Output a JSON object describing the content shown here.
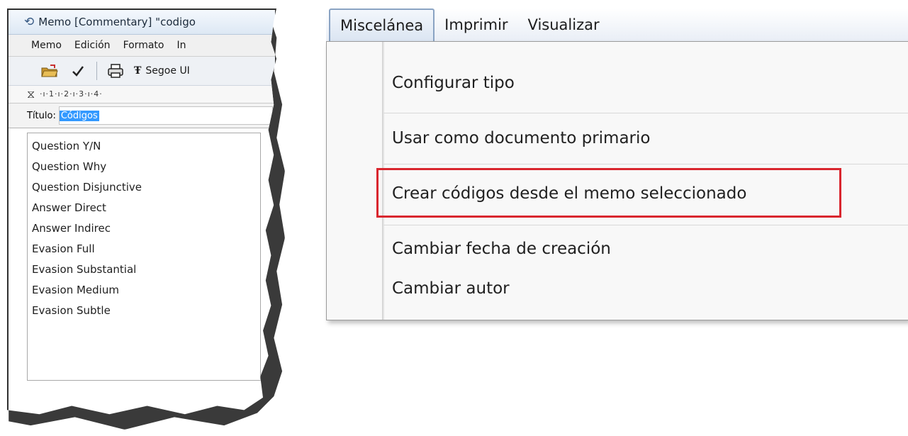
{
  "memo_window": {
    "title": "Memo [Commentary] \"codigo",
    "menu": [
      "Memo",
      "Edición",
      "Formato",
      "In"
    ],
    "font_name": "Segoe UI",
    "ruler_text": "·ı·1·ı·2·ı·3·ı·4·",
    "title_label": "Título:",
    "title_value": "Códigos",
    "lines": [
      "Question Y/N",
      "Question Why",
      "Question Disjunctive",
      "Answer Direct",
      "Answer Indirec",
      "Evasion Full",
      "Evasion Substantial",
      "Evasion Medium",
      "Evasion Subtle"
    ]
  },
  "menu_bar": {
    "items": [
      "Miscelánea",
      "Imprimir",
      "Visualizar"
    ],
    "active": "Miscelánea"
  },
  "dropdown": {
    "items": [
      "Configurar tipo",
      "Usar como documento primario",
      "Crear códigos desde el memo seleccionado",
      "Cambiar fecha de creación",
      "Cambiar autor"
    ],
    "highlighted_index": 2,
    "highlight_color": "#d9262e"
  }
}
